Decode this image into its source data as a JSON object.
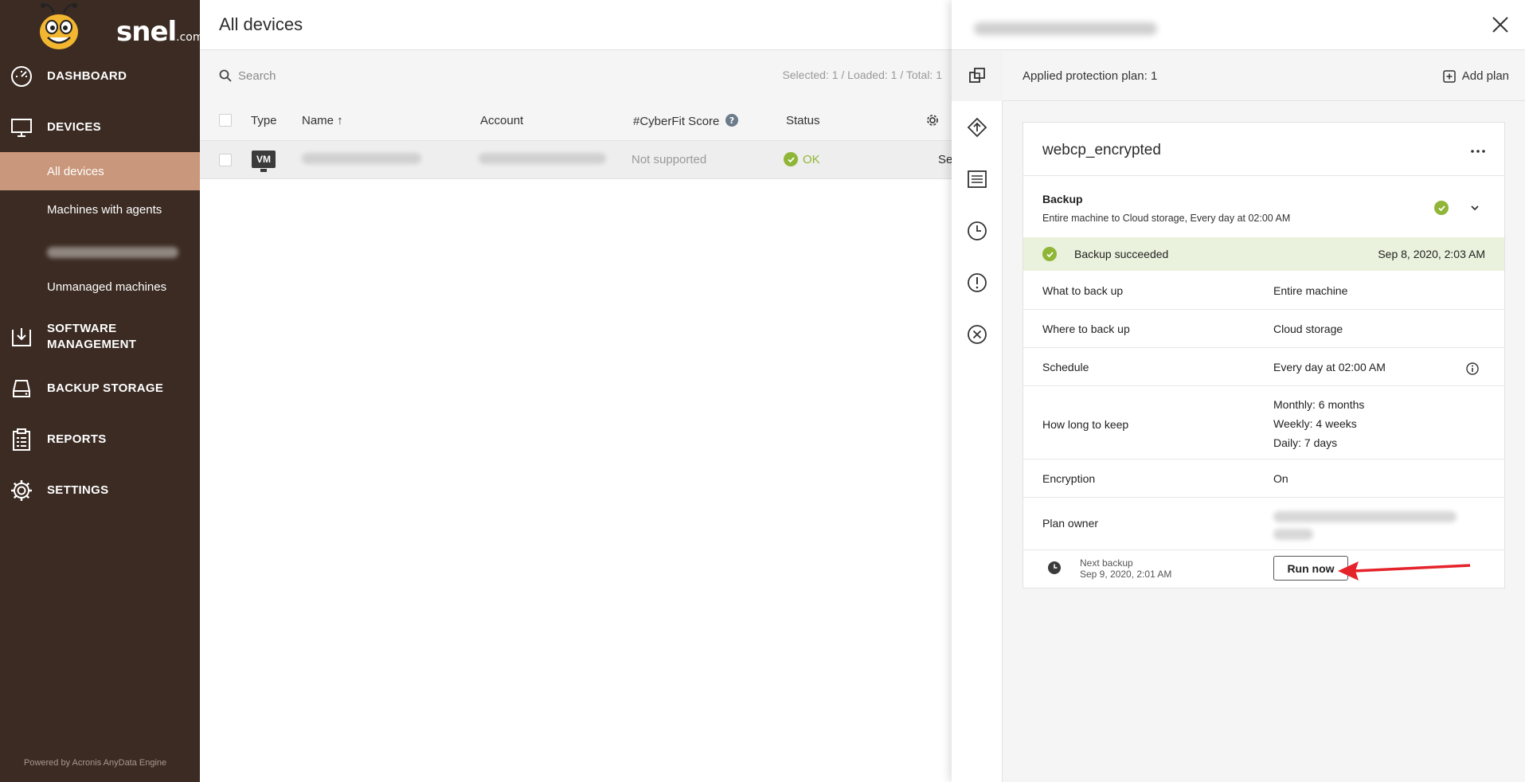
{
  "brand": {
    "name": "snel",
    "suffix": ".com"
  },
  "sidebar": {
    "nav": [
      {
        "label": "DASHBOARD",
        "icon": "dashboard-icon"
      },
      {
        "label": "DEVICES",
        "icon": "monitor-icon"
      },
      {
        "label": "SOFTWARE MANAGEMENT",
        "icon": "software-download-icon"
      },
      {
        "label": "BACKUP STORAGE",
        "icon": "storage-drive-icon"
      },
      {
        "label": "REPORTS",
        "icon": "clipboard-report-icon"
      },
      {
        "label": "SETTINGS",
        "icon": "gear-icon"
      }
    ],
    "devices_sub": [
      {
        "label": "All devices",
        "active": true
      },
      {
        "label": "Machines with agents"
      },
      {
        "label": ""
      },
      {
        "label": "Unmanaged machines"
      }
    ],
    "footer": "Powered by Acronis AnyData Engine",
    "colors": {
      "bg": "#3b2b23",
      "active": "#c9977b"
    }
  },
  "main": {
    "title": "All devices",
    "search_placeholder": "Search",
    "counts": "Selected: 1 / Loaded: 1 / Total: 1",
    "columns": [
      "Type",
      "Name ↑",
      "Account",
      "#CyberFit Score",
      "Status"
    ],
    "rows": [
      {
        "type": "VM",
        "name": "",
        "account": "",
        "cyberfit": "Not supported",
        "status": "OK",
        "extra": "Se"
      }
    ]
  },
  "panel": {
    "applied_plan": "Applied protection plan: 1",
    "add_plan": "Add plan",
    "plan_name": "webcp_encrypted",
    "backup": {
      "title": "Backup",
      "summary": "Entire machine to Cloud storage, Every day at 02:00 AM",
      "status_label": "Backup succeeded",
      "status_date": "Sep 8, 2020, 2:03 AM"
    },
    "properties": [
      {
        "label": "What to back up",
        "value": "Entire machine"
      },
      {
        "label": "Where to back up",
        "value": "Cloud storage"
      },
      {
        "label": "Schedule",
        "value": "Every day at 02:00 AM"
      },
      {
        "label": "How long to keep",
        "values": [
          "Monthly: 6 months",
          "Weekly: 4 weeks",
          "Daily: 7 days"
        ]
      },
      {
        "label": "Encryption",
        "value": "On"
      },
      {
        "label": "Plan owner",
        "value": ""
      }
    ],
    "next_backup": {
      "label": "Next backup",
      "date": "Sep 9, 2020, 2:01 AM"
    },
    "run_now": "Run now",
    "accent": "#8fb636",
    "annotation_color": "#e5232a"
  }
}
